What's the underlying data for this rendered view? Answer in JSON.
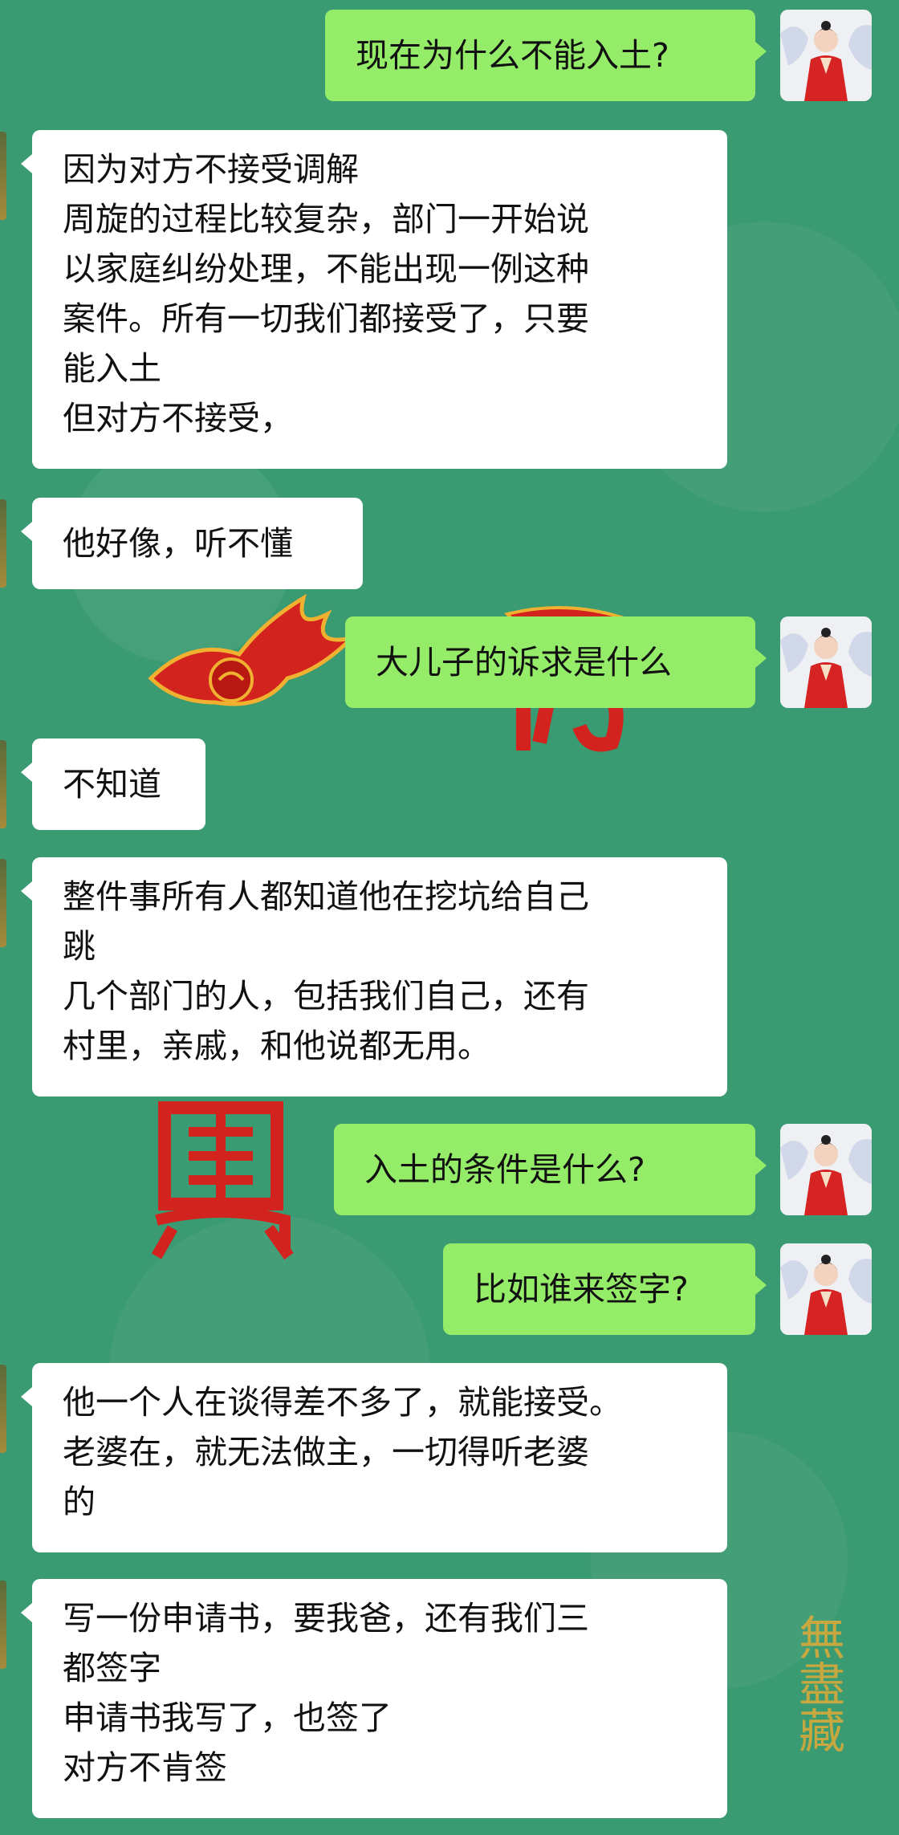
{
  "messages": [
    {
      "side": "out",
      "text": "现在为什么不能入土?"
    },
    {
      "side": "in",
      "text": "因为对方不接受调解\n周旋的过程比较复杂，部门一开始说\n以家庭纠纷处理，不能出现一例这种\n案件。所有一切我们都接受了，只要\n能入土\n但对方不接受，"
    },
    {
      "side": "in",
      "text": "他好像，听不懂"
    },
    {
      "side": "out",
      "text": "大儿子的诉求是什么"
    },
    {
      "side": "in",
      "text": "不知道"
    },
    {
      "side": "in",
      "text": "整件事所有人都知道他在挖坑给自己\n跳\n几个部门的人，包括我们自己，还有\n村里，亲戚，和他说都无用。"
    },
    {
      "side": "out",
      "text": "入土的条件是什么?"
    },
    {
      "side": "out",
      "text": "比如谁来签字?"
    },
    {
      "side": "in",
      "text": "他一个人在谈得差不多了，就能接受。\n老婆在，就无法做主，一切得听老婆\n的"
    },
    {
      "side": "in",
      "text": "写一份申请书，要我爸，还有我们三\n都签字\n申请书我写了，也签了\n对方不肯签"
    }
  ],
  "wallpaper_seal_text": "無盡藏",
  "colors": {
    "background": "#3a9a72",
    "incoming_bubble": "#ffffff",
    "outgoing_bubble": "#95ec69"
  }
}
